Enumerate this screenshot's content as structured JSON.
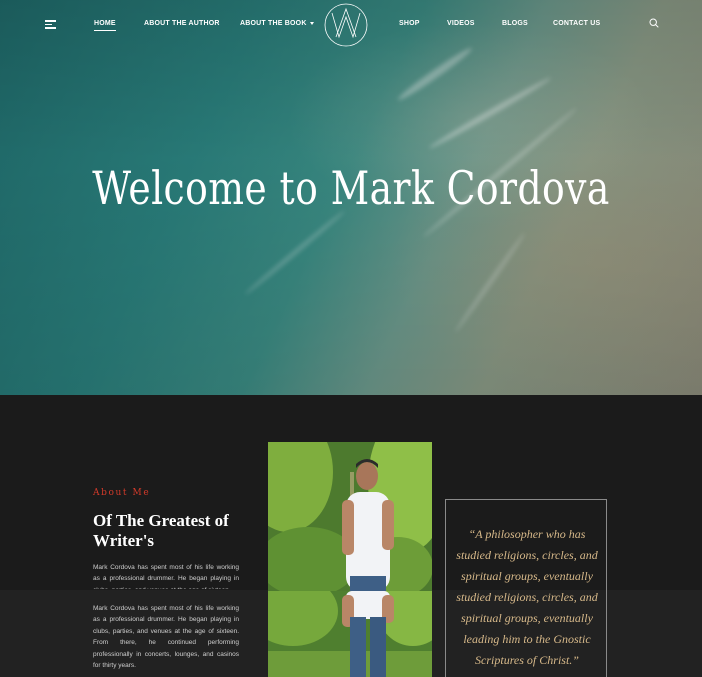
{
  "nav": {
    "items": [
      {
        "label": "HOME",
        "active": true
      },
      {
        "label": "ABOUT THE AUTHOR"
      },
      {
        "label": "ABOUT THE BOOK",
        "has_dropdown": true
      },
      {
        "label": "SHOP"
      },
      {
        "label": "VIDEOS"
      },
      {
        "label": "BLOGS"
      },
      {
        "label": "CONTACT US"
      }
    ],
    "icons": {
      "menu": "hamburger-menu-icon",
      "logo": "monogram-logo",
      "search": "search-icon"
    }
  },
  "hero": {
    "title": "Welcome to Mark Cordova"
  },
  "about": {
    "eyebrow": "About Me",
    "heading": "Of The Greatest of Writer's",
    "paragraph_1": "Mark Cordova has spent most of his life working as a professional drummer. He began playing in clubs, parties, and venues at the age of sixteen.",
    "paragraph_2": "Mark Cordova has spent most of his life working as a professional drummer. He began playing in clubs, parties, and venues at the age of sixteen. From there, he continued performing professionally in concerts, lounges, and casinos for thirty years.",
    "quote": "“A philosopher who has studied religions, circles, and spiritual groups, eventually studied religions, circles, and spiritual groups, eventually leading him to the Gnostic Scriptures of Christ.”"
  },
  "colors": {
    "accent_red": "#d23a2a",
    "quote_gold": "#d7b98a",
    "section_bg": "#1b1b1b"
  }
}
